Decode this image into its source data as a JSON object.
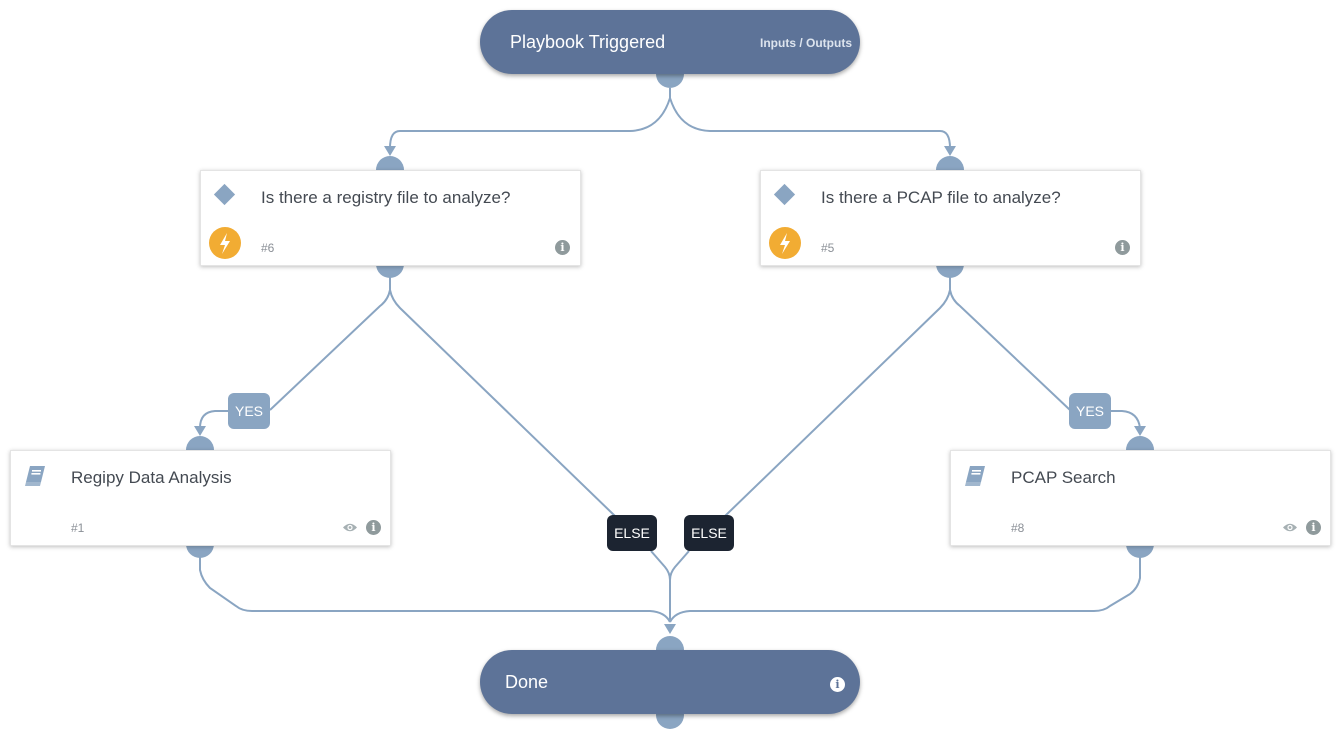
{
  "colors": {
    "pill_bg": "#5d7398",
    "connector": "#8aa5c2",
    "condition_label": "#8aa5c2",
    "else_label": "#1c2431",
    "bolt": "#f2ac33",
    "card_bg": "#ffffff"
  },
  "start_node": {
    "title": "Playbook Triggered",
    "link_label": "Inputs / Outputs"
  },
  "end_node": {
    "title": "Done",
    "icon": "info-icon"
  },
  "tasks": [
    {
      "id": "#6",
      "type": "condition",
      "title": "Is there a registry file to analyze?",
      "icons": [
        "diamond-icon",
        "bolt-icon",
        "info-icon"
      ]
    },
    {
      "id": "#5",
      "type": "condition",
      "title": "Is there a PCAP file to analyze?",
      "icons": [
        "diamond-icon",
        "bolt-icon",
        "info-icon"
      ]
    },
    {
      "id": "#1",
      "type": "playbook",
      "title": "Regipy Data Analysis",
      "icons": [
        "book-icon",
        "eye-icon",
        "info-icon"
      ]
    },
    {
      "id": "#8",
      "type": "playbook",
      "title": "PCAP Search",
      "icons": [
        "book-icon",
        "eye-icon",
        "info-icon"
      ]
    }
  ],
  "branch_labels": {
    "yes_left": "YES",
    "yes_right": "YES",
    "else_left": "ELSE",
    "else_right": "ELSE"
  },
  "info_glyph": "i",
  "edges": [
    {
      "from": "Playbook Triggered",
      "to": "#6"
    },
    {
      "from": "Playbook Triggered",
      "to": "#5"
    },
    {
      "from": "#6",
      "to": "#1",
      "label": "YES"
    },
    {
      "from": "#6",
      "to": "Done",
      "label": "ELSE"
    },
    {
      "from": "#5",
      "to": "#8",
      "label": "YES"
    },
    {
      "from": "#5",
      "to": "Done",
      "label": "ELSE"
    },
    {
      "from": "#1",
      "to": "Done"
    },
    {
      "from": "#8",
      "to": "Done"
    }
  ]
}
